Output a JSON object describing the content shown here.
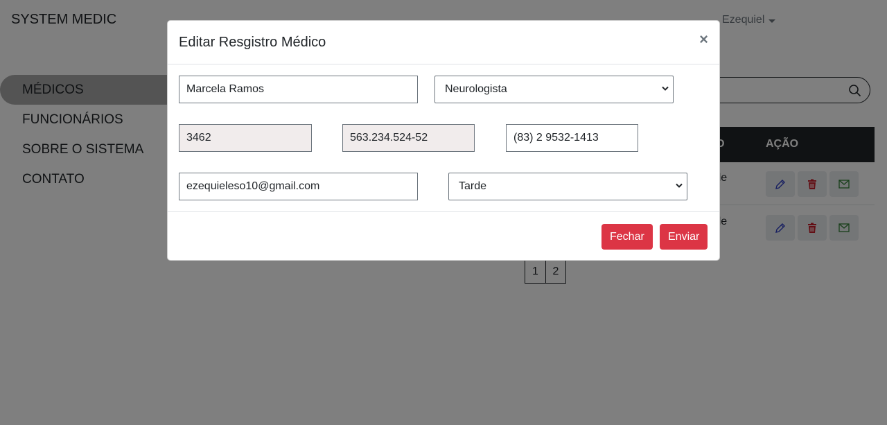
{
  "app": {
    "brand": "SYSTEM MEDIC",
    "user_name": "Ezequiel"
  },
  "sidebar": {
    "items": [
      {
        "label": "MÉDICOS"
      },
      {
        "label": "FUNCIONÁRIOS"
      },
      {
        "label": "SOBRE O SISTEMA"
      },
      {
        "label": "CONTATO"
      }
    ]
  },
  "table": {
    "headers": {
      "turno": "RNO",
      "acao": "AÇÃO"
    },
    "rows": [
      {
        "turno": "rde"
      },
      {
        "turno": "rde"
      }
    ]
  },
  "pagination": {
    "pages": [
      "1",
      "2"
    ]
  },
  "modal": {
    "title": "Editar Resgistro Médico",
    "close_label": "×",
    "fields": {
      "name": "Marcela Ramos",
      "specialty": "Neurologista",
      "code": "3462",
      "cpf": "563.234.524-52",
      "phone": "(83) 2 9532-1413",
      "email": "ezequieleso10@gmail.com",
      "shift": "Tarde"
    },
    "buttons": {
      "close": "Fechar",
      "send": "Enviar"
    }
  },
  "colors": {
    "danger": "#dc3545",
    "dark": "#212529",
    "readonly_bg": "#f1ecec",
    "edit_icon": "#2f3ec2",
    "delete_icon": "#c61f2b",
    "mail_icon": "#2e7d32"
  }
}
